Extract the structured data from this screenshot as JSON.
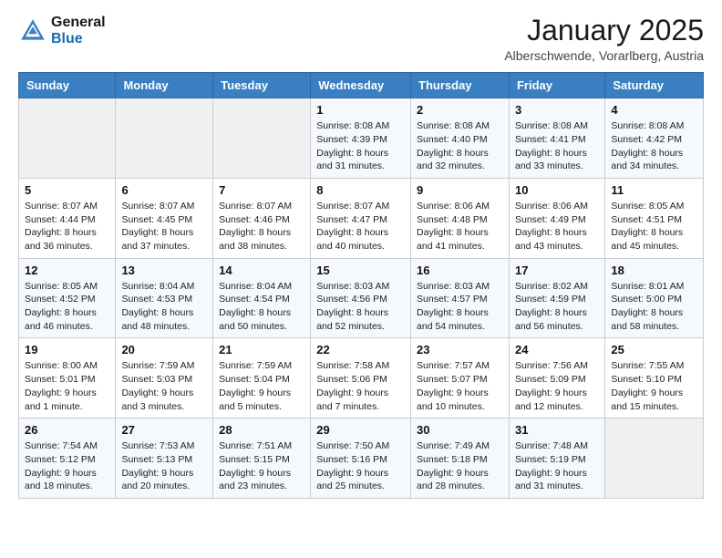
{
  "header": {
    "logo_general": "General",
    "logo_blue": "Blue",
    "month_title": "January 2025",
    "location": "Alberschwende, Vorarlberg, Austria"
  },
  "weekdays": [
    "Sunday",
    "Monday",
    "Tuesday",
    "Wednesday",
    "Thursday",
    "Friday",
    "Saturday"
  ],
  "weeks": [
    [
      {
        "day": "",
        "sunrise": "",
        "sunset": "",
        "daylight": ""
      },
      {
        "day": "",
        "sunrise": "",
        "sunset": "",
        "daylight": ""
      },
      {
        "day": "",
        "sunrise": "",
        "sunset": "",
        "daylight": ""
      },
      {
        "day": "1",
        "sunrise": "Sunrise: 8:08 AM",
        "sunset": "Sunset: 4:39 PM",
        "daylight": "Daylight: 8 hours and 31 minutes."
      },
      {
        "day": "2",
        "sunrise": "Sunrise: 8:08 AM",
        "sunset": "Sunset: 4:40 PM",
        "daylight": "Daylight: 8 hours and 32 minutes."
      },
      {
        "day": "3",
        "sunrise": "Sunrise: 8:08 AM",
        "sunset": "Sunset: 4:41 PM",
        "daylight": "Daylight: 8 hours and 33 minutes."
      },
      {
        "day": "4",
        "sunrise": "Sunrise: 8:08 AM",
        "sunset": "Sunset: 4:42 PM",
        "daylight": "Daylight: 8 hours and 34 minutes."
      }
    ],
    [
      {
        "day": "5",
        "sunrise": "Sunrise: 8:07 AM",
        "sunset": "Sunset: 4:44 PM",
        "daylight": "Daylight: 8 hours and 36 minutes."
      },
      {
        "day": "6",
        "sunrise": "Sunrise: 8:07 AM",
        "sunset": "Sunset: 4:45 PM",
        "daylight": "Daylight: 8 hours and 37 minutes."
      },
      {
        "day": "7",
        "sunrise": "Sunrise: 8:07 AM",
        "sunset": "Sunset: 4:46 PM",
        "daylight": "Daylight: 8 hours and 38 minutes."
      },
      {
        "day": "8",
        "sunrise": "Sunrise: 8:07 AM",
        "sunset": "Sunset: 4:47 PM",
        "daylight": "Daylight: 8 hours and 40 minutes."
      },
      {
        "day": "9",
        "sunrise": "Sunrise: 8:06 AM",
        "sunset": "Sunset: 4:48 PM",
        "daylight": "Daylight: 8 hours and 41 minutes."
      },
      {
        "day": "10",
        "sunrise": "Sunrise: 8:06 AM",
        "sunset": "Sunset: 4:49 PM",
        "daylight": "Daylight: 8 hours and 43 minutes."
      },
      {
        "day": "11",
        "sunrise": "Sunrise: 8:05 AM",
        "sunset": "Sunset: 4:51 PM",
        "daylight": "Daylight: 8 hours and 45 minutes."
      }
    ],
    [
      {
        "day": "12",
        "sunrise": "Sunrise: 8:05 AM",
        "sunset": "Sunset: 4:52 PM",
        "daylight": "Daylight: 8 hours and 46 minutes."
      },
      {
        "day": "13",
        "sunrise": "Sunrise: 8:04 AM",
        "sunset": "Sunset: 4:53 PM",
        "daylight": "Daylight: 8 hours and 48 minutes."
      },
      {
        "day": "14",
        "sunrise": "Sunrise: 8:04 AM",
        "sunset": "Sunset: 4:54 PM",
        "daylight": "Daylight: 8 hours and 50 minutes."
      },
      {
        "day": "15",
        "sunrise": "Sunrise: 8:03 AM",
        "sunset": "Sunset: 4:56 PM",
        "daylight": "Daylight: 8 hours and 52 minutes."
      },
      {
        "day": "16",
        "sunrise": "Sunrise: 8:03 AM",
        "sunset": "Sunset: 4:57 PM",
        "daylight": "Daylight: 8 hours and 54 minutes."
      },
      {
        "day": "17",
        "sunrise": "Sunrise: 8:02 AM",
        "sunset": "Sunset: 4:59 PM",
        "daylight": "Daylight: 8 hours and 56 minutes."
      },
      {
        "day": "18",
        "sunrise": "Sunrise: 8:01 AM",
        "sunset": "Sunset: 5:00 PM",
        "daylight": "Daylight: 8 hours and 58 minutes."
      }
    ],
    [
      {
        "day": "19",
        "sunrise": "Sunrise: 8:00 AM",
        "sunset": "Sunset: 5:01 PM",
        "daylight": "Daylight: 9 hours and 1 minute."
      },
      {
        "day": "20",
        "sunrise": "Sunrise: 7:59 AM",
        "sunset": "Sunset: 5:03 PM",
        "daylight": "Daylight: 9 hours and 3 minutes."
      },
      {
        "day": "21",
        "sunrise": "Sunrise: 7:59 AM",
        "sunset": "Sunset: 5:04 PM",
        "daylight": "Daylight: 9 hours and 5 minutes."
      },
      {
        "day": "22",
        "sunrise": "Sunrise: 7:58 AM",
        "sunset": "Sunset: 5:06 PM",
        "daylight": "Daylight: 9 hours and 7 minutes."
      },
      {
        "day": "23",
        "sunrise": "Sunrise: 7:57 AM",
        "sunset": "Sunset: 5:07 PM",
        "daylight": "Daylight: 9 hours and 10 minutes."
      },
      {
        "day": "24",
        "sunrise": "Sunrise: 7:56 AM",
        "sunset": "Sunset: 5:09 PM",
        "daylight": "Daylight: 9 hours and 12 minutes."
      },
      {
        "day": "25",
        "sunrise": "Sunrise: 7:55 AM",
        "sunset": "Sunset: 5:10 PM",
        "daylight": "Daylight: 9 hours and 15 minutes."
      }
    ],
    [
      {
        "day": "26",
        "sunrise": "Sunrise: 7:54 AM",
        "sunset": "Sunset: 5:12 PM",
        "daylight": "Daylight: 9 hours and 18 minutes."
      },
      {
        "day": "27",
        "sunrise": "Sunrise: 7:53 AM",
        "sunset": "Sunset: 5:13 PM",
        "daylight": "Daylight: 9 hours and 20 minutes."
      },
      {
        "day": "28",
        "sunrise": "Sunrise: 7:51 AM",
        "sunset": "Sunset: 5:15 PM",
        "daylight": "Daylight: 9 hours and 23 minutes."
      },
      {
        "day": "29",
        "sunrise": "Sunrise: 7:50 AM",
        "sunset": "Sunset: 5:16 PM",
        "daylight": "Daylight: 9 hours and 25 minutes."
      },
      {
        "day": "30",
        "sunrise": "Sunrise: 7:49 AM",
        "sunset": "Sunset: 5:18 PM",
        "daylight": "Daylight: 9 hours and 28 minutes."
      },
      {
        "day": "31",
        "sunrise": "Sunrise: 7:48 AM",
        "sunset": "Sunset: 5:19 PM",
        "daylight": "Daylight: 9 hours and 31 minutes."
      },
      {
        "day": "",
        "sunrise": "",
        "sunset": "",
        "daylight": ""
      }
    ]
  ]
}
